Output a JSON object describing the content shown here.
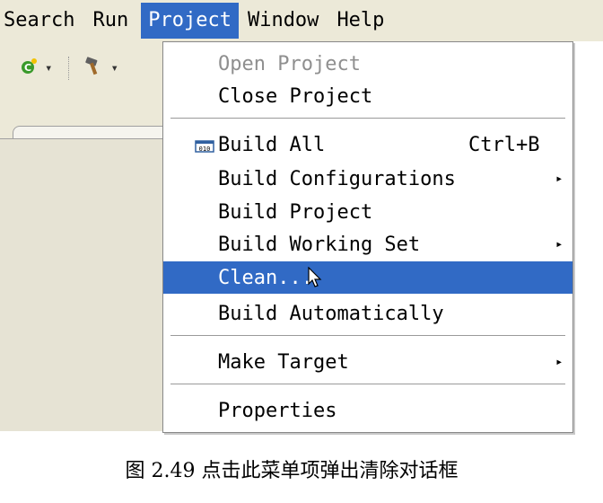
{
  "menubar": {
    "items": [
      {
        "label": "Search"
      },
      {
        "label": "Run"
      },
      {
        "label": "Project"
      },
      {
        "label": "Window"
      },
      {
        "label": "Help"
      }
    ],
    "active_index": 2,
    "active_color": "#316ac5"
  },
  "toolbar": {
    "buttons": [
      {
        "icon": "new-wizard-icon",
        "dropdown": "▾"
      },
      {
        "icon": "build-hammer-icon",
        "dropdown": "▾"
      }
    ]
  },
  "project_menu": {
    "items": [
      {
        "label": "Open Project",
        "enabled": false
      },
      {
        "label": "Close Project",
        "enabled": true
      },
      {
        "label": "Build All",
        "accelerator": "Ctrl+B",
        "icon": "build-all-icon"
      },
      {
        "label": "Build Configurations",
        "submenu": "▸"
      },
      {
        "label": "Build Project"
      },
      {
        "label": "Build Working Set",
        "submenu": "▸"
      },
      {
        "label": "Clean...",
        "selected": true
      },
      {
        "label": "Build Automatically"
      },
      {
        "label": "Make Target",
        "submenu": "▸"
      },
      {
        "label": "Properties"
      }
    ]
  },
  "caption": "图 2.49 点击此菜单项弹出清除对话框"
}
